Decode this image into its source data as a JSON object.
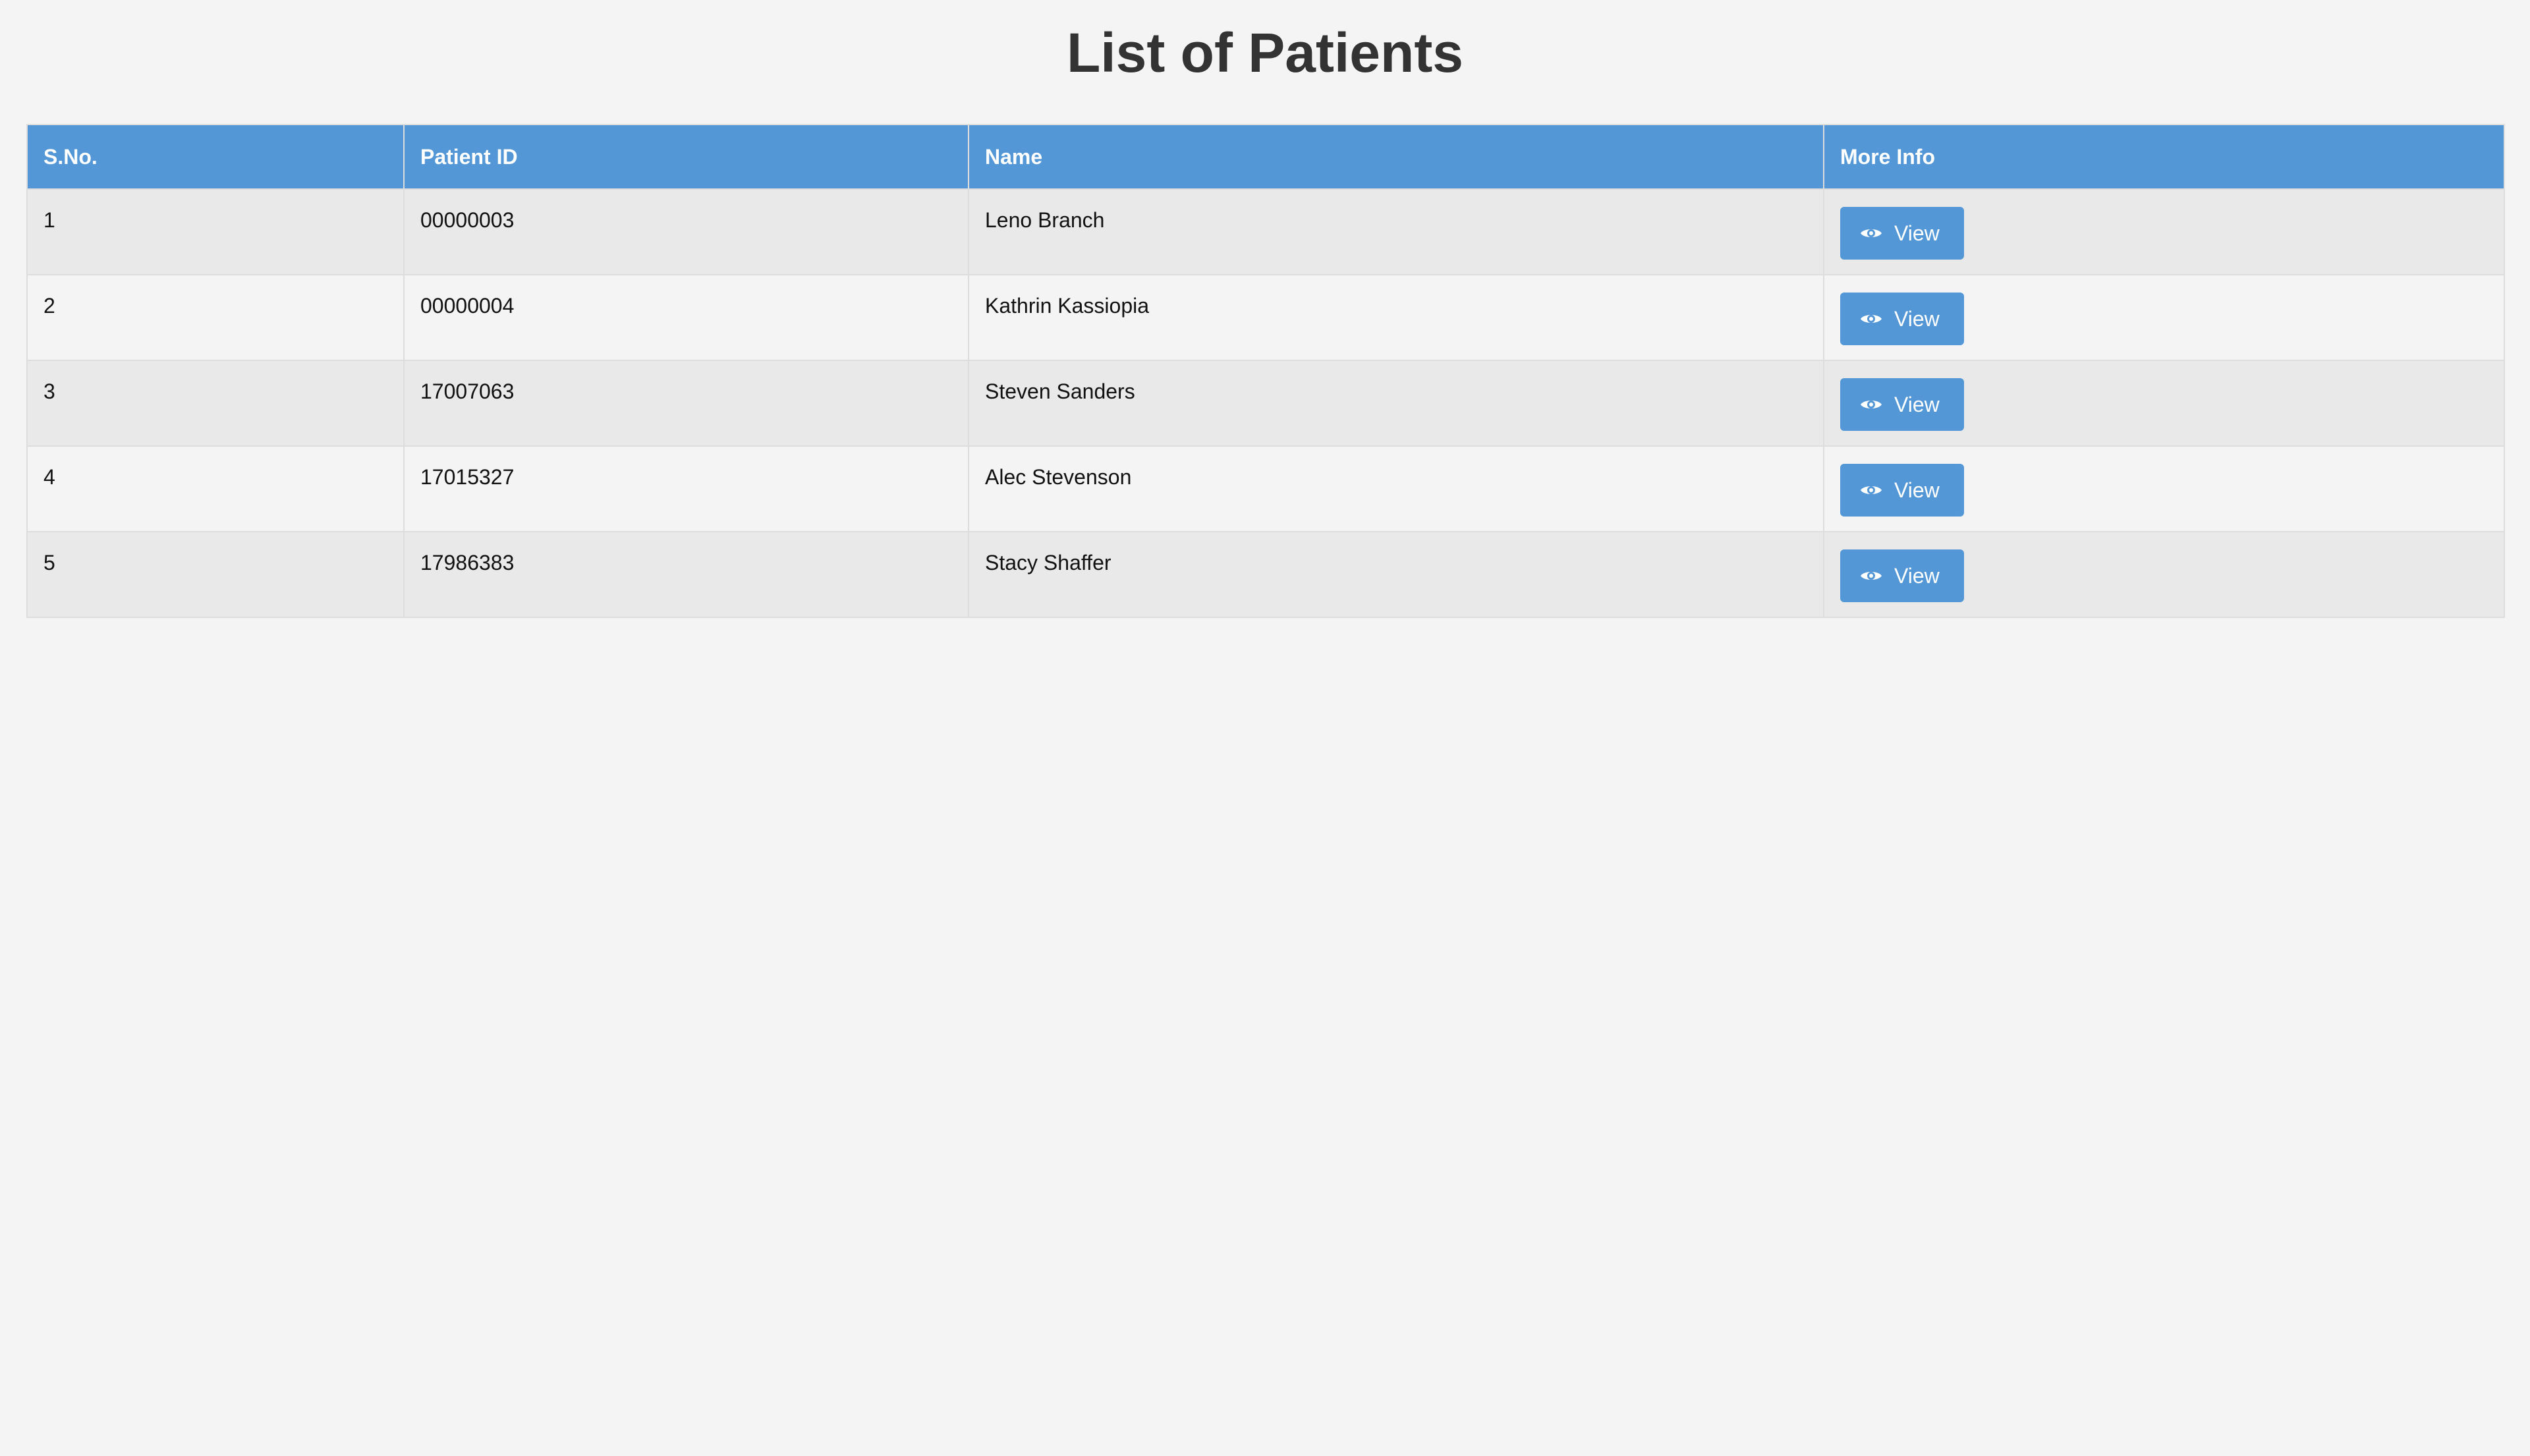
{
  "page": {
    "title": "List of Patients"
  },
  "table": {
    "headers": {
      "sno": "S.No.",
      "patient_id": "Patient ID",
      "name": "Name",
      "more_info": "More Info"
    },
    "rows": [
      {
        "sno": "1",
        "patient_id": "00000003",
        "name": "Leno Branch",
        "action_label": "View"
      },
      {
        "sno": "2",
        "patient_id": "00000004",
        "name": "Kathrin Kassiopia",
        "action_label": "View"
      },
      {
        "sno": "3",
        "patient_id": "17007063",
        "name": "Steven Sanders",
        "action_label": "View"
      },
      {
        "sno": "4",
        "patient_id": "17015327",
        "name": "Alec Stevenson",
        "action_label": "View"
      },
      {
        "sno": "5",
        "patient_id": "17986383",
        "name": "Stacy Shaffer",
        "action_label": "View"
      }
    ],
    "action_icon": "eye-icon"
  },
  "colors": {
    "accent": "#5397d6",
    "background": "#f4f4f4",
    "row_alt": "#e9e9e9",
    "title": "#333333"
  }
}
